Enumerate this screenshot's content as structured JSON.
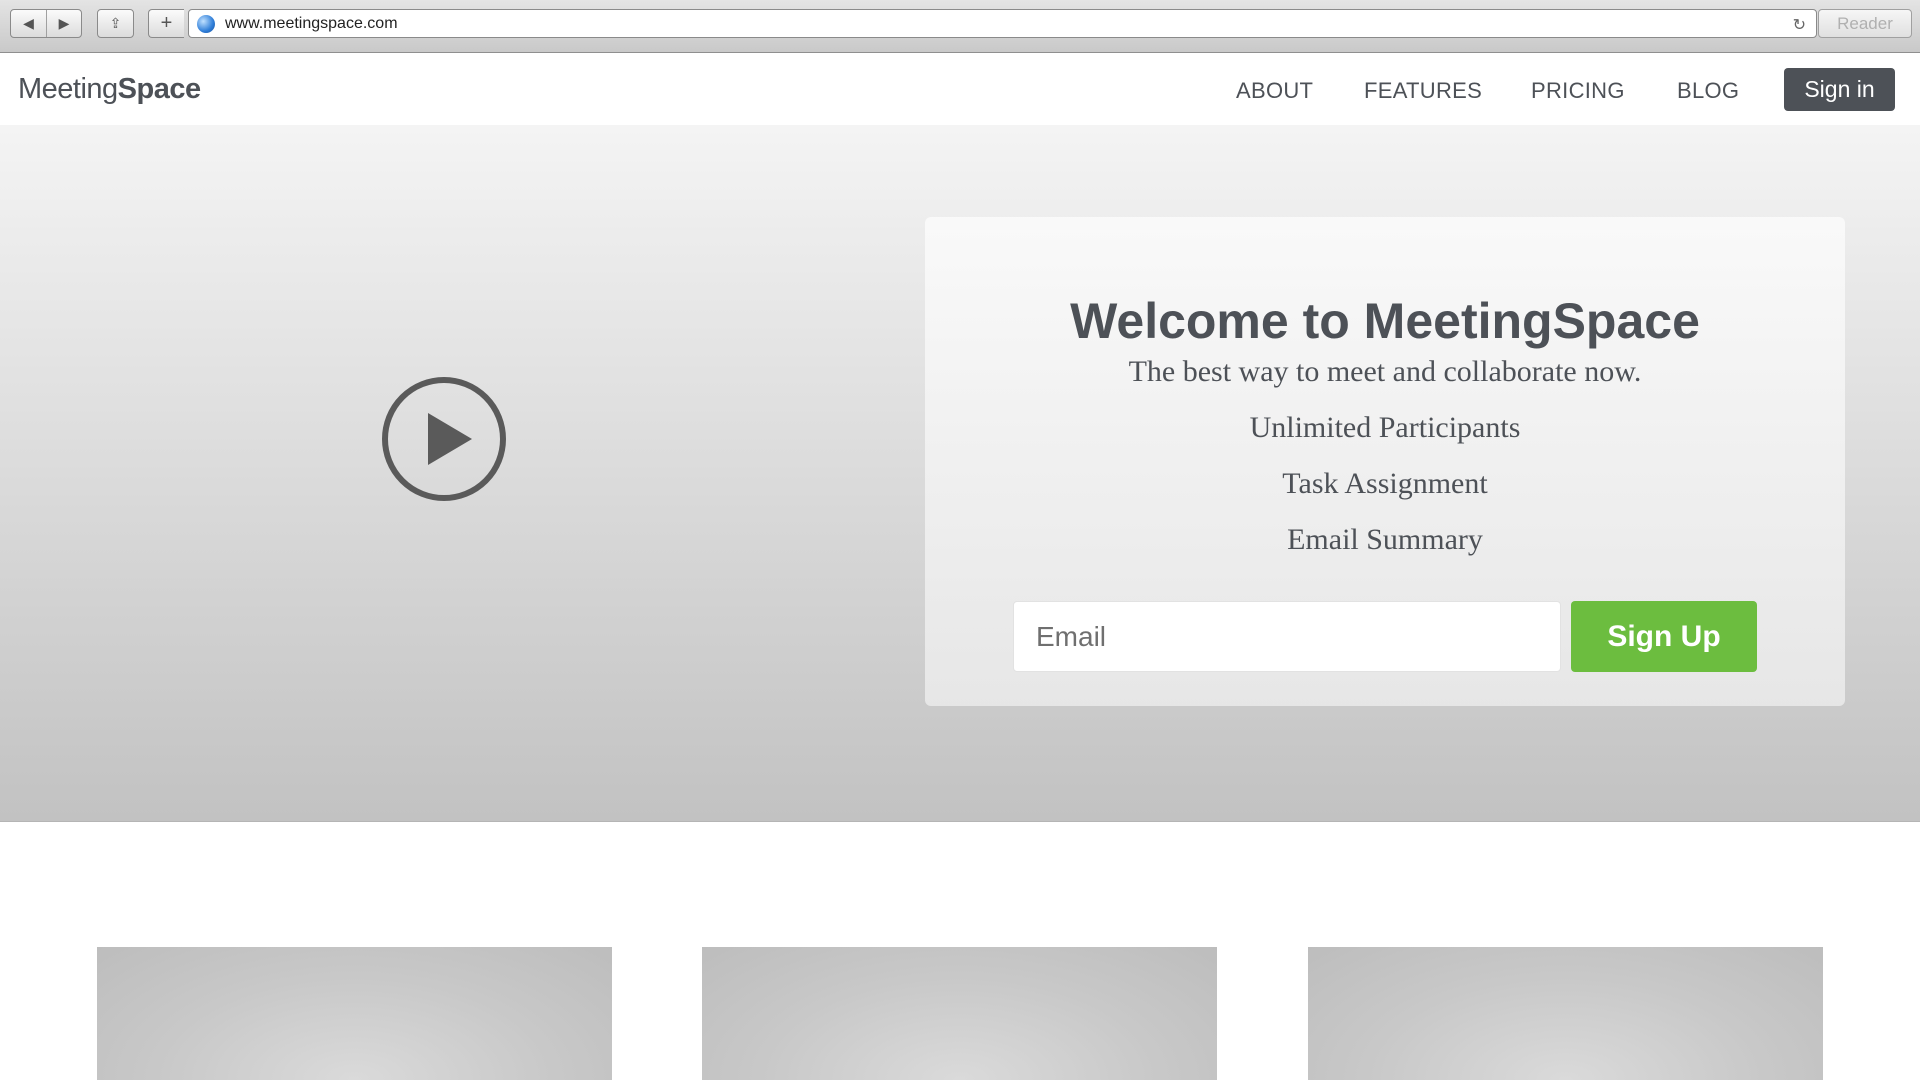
{
  "browser": {
    "url": "www.meetingspace.com",
    "reader_label": "Reader",
    "buttons": {
      "back": "◀",
      "forward": "▶",
      "share": "⇪",
      "new_tab": "+",
      "reload": "↻"
    }
  },
  "header": {
    "logo_light": "Meeting",
    "logo_bold": "Space",
    "nav": {
      "about": "ABOUT",
      "features": "FEATURES",
      "pricing": "PRICING",
      "blog": "BLOG"
    },
    "signin_label": "Sign in"
  },
  "hero": {
    "play_icon": "play-circle-icon",
    "title": "Welcome to MeetingSpace",
    "tagline": "The best way to meet and collaborate now.",
    "features": [
      "Unlimited Participants",
      "Task Assignment",
      "Email Summary"
    ],
    "email_placeholder": "Email",
    "email_value": "",
    "signup_label": "Sign Up"
  },
  "colors": {
    "text_dark": "#4d5157",
    "signup_green": "#6cbd3f",
    "signin_bg": "#4d5157"
  }
}
